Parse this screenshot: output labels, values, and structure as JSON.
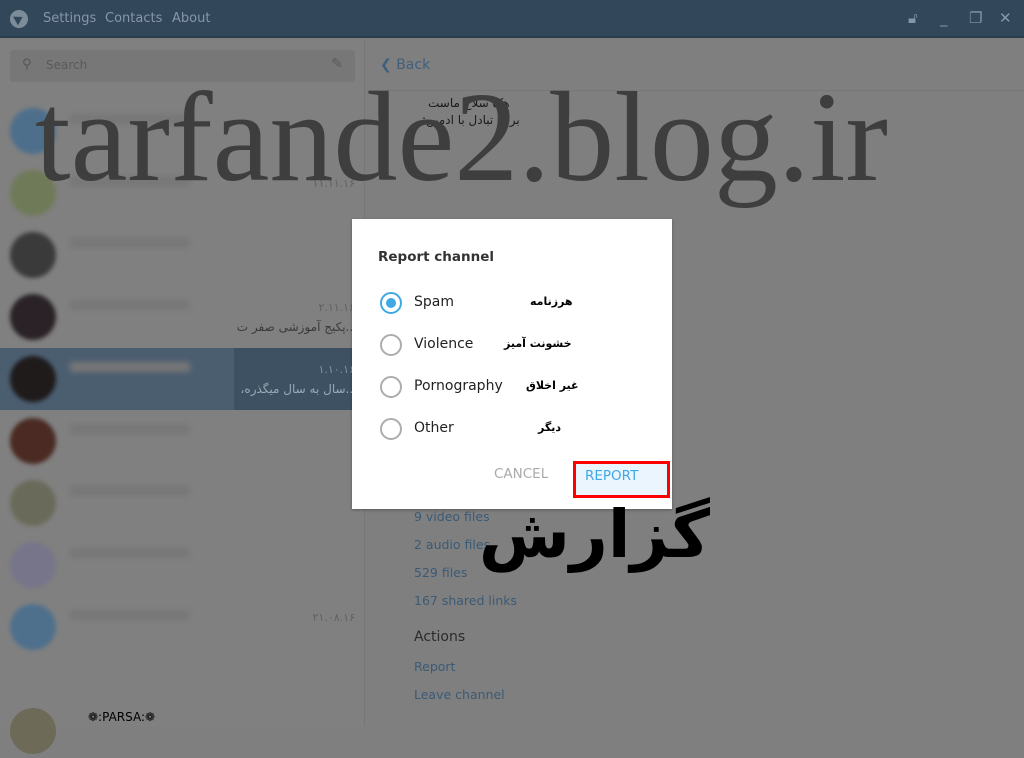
{
  "titlebar": {
    "menu": [
      "Settings",
      "Contacts",
      "About"
    ],
    "controls": [
      "lock-icon",
      "minimize-icon",
      "restore-icon",
      "close-icon"
    ]
  },
  "search": {
    "placeholder": "Search"
  },
  "chats": [
    {
      "date": "",
      "preview": "",
      "avatar_color": "#4d6f8c"
    },
    {
      "date": "۱۱.۱۱.۱۶",
      "preview": "",
      "avatar_color": "#6f7a58"
    },
    {
      "date": "",
      "preview": "",
      "avatar_color": "#3a3a3a"
    },
    {
      "date": "۲.۱۱.۱۶",
      "preview": "...پکیج آموزشی صفر ت",
      "avatar_color": "#2a2226"
    },
    {
      "date": "۱.۱۰.۱۶",
      "preview": "...سال به سال میگذره،",
      "avatar_color": "#1f1b1b",
      "selected": true
    },
    {
      "date": "",
      "preview": "",
      "avatar_color": "#4a2a22"
    },
    {
      "date": "",
      "preview": "",
      "avatar_color": "#6a6a5a"
    },
    {
      "date": "",
      "preview": "",
      "avatar_color": "#76758a"
    },
    {
      "date": "۲۱.۰۸.۱۶",
      "preview": "",
      "avatar_color": "#4e708d"
    }
  ],
  "user": {
    "name": "❁:PARSA:❁"
  },
  "main": {
    "back": "Back",
    "desc_lines": [
      "هک سلاح ماست",
      "برای تبادل با ادمین:"
    ],
    "media": [
      "9 video files",
      "2 audio files",
      "529 files",
      "167 shared links"
    ],
    "actions_title": "Actions",
    "actions": [
      "Report",
      "Leave channel"
    ]
  },
  "watermark": "tarfande2.blog.ir",
  "annotation": "گزارش",
  "dialog": {
    "title": "Report channel",
    "options": [
      {
        "label": "Spam",
        "fa": "هرزنامه",
        "selected": true
      },
      {
        "label": "Violence",
        "fa": "خشونت آمیز",
        "selected": false
      },
      {
        "label": "Pornography",
        "fa": "غیر اخلاق",
        "selected": false
      },
      {
        "label": "Other",
        "fa": "دیگر",
        "selected": false
      }
    ],
    "cancel": "CANCEL",
    "report": "REPORT"
  },
  "colors": {
    "accent": "#3fa9e6",
    "highlight": "#ff0000",
    "titlebar": "#33475a"
  }
}
